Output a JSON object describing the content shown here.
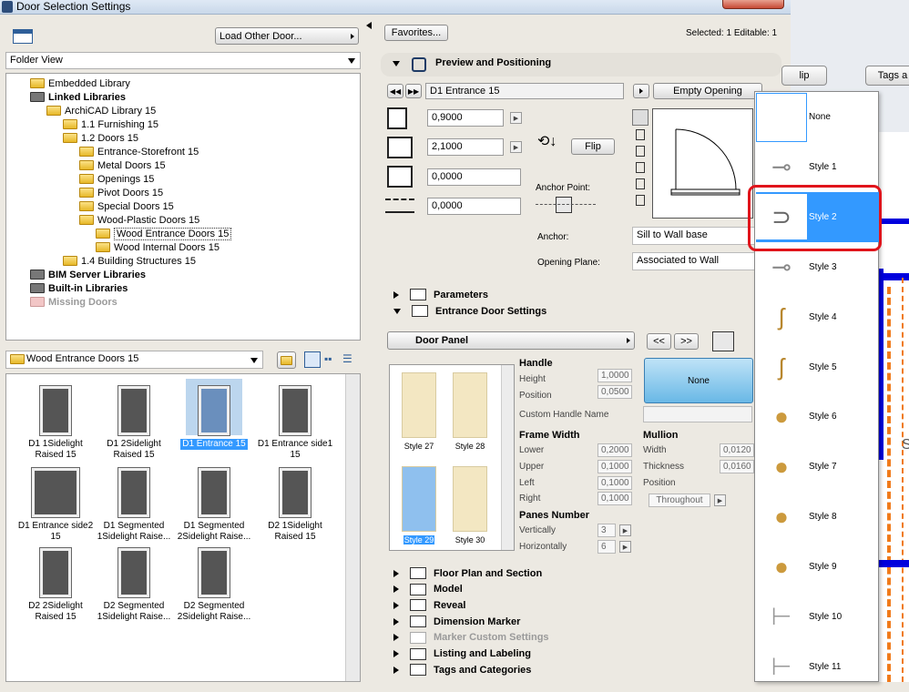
{
  "window": {
    "title": "Door Selection Settings"
  },
  "left": {
    "load_button": "Load Other Door...",
    "view_select": "Folder View",
    "tree": [
      {
        "label": "Embedded Library",
        "depth": 1,
        "bold": false,
        "grey": false
      },
      {
        "label": "Linked Libraries",
        "depth": 1,
        "bold": true,
        "grey": false
      },
      {
        "label": "ArchiCAD Library 15",
        "depth": 2,
        "bold": false,
        "grey": false
      },
      {
        "label": "1.1 Furnishing 15",
        "depth": 3,
        "bold": false,
        "grey": false
      },
      {
        "label": "1.2 Doors 15",
        "depth": 3,
        "bold": false,
        "grey": false
      },
      {
        "label": "Entrance-Storefront 15",
        "depth": 4,
        "bold": false,
        "grey": false
      },
      {
        "label": "Metal Doors 15",
        "depth": 4,
        "bold": false,
        "grey": false
      },
      {
        "label": "Openings 15",
        "depth": 4,
        "bold": false,
        "grey": false
      },
      {
        "label": "Pivot Doors 15",
        "depth": 4,
        "bold": false,
        "grey": false
      },
      {
        "label": "Special Doors 15",
        "depth": 4,
        "bold": false,
        "grey": false
      },
      {
        "label": "Wood-Plastic Doors 15",
        "depth": 4,
        "bold": false,
        "grey": false
      },
      {
        "label": "Wood Entrance Doors 15",
        "depth": 5,
        "bold": false,
        "grey": false,
        "selected": true
      },
      {
        "label": "Wood Internal Doors 15",
        "depth": 5,
        "bold": false,
        "grey": false
      },
      {
        "label": "1.4 Building Structures 15",
        "depth": 3,
        "bold": false,
        "grey": false
      },
      {
        "label": "BIM Server Libraries",
        "depth": 1,
        "bold": true,
        "grey": false
      },
      {
        "label": "Built-in Libraries",
        "depth": 1,
        "bold": true,
        "grey": false
      },
      {
        "label": "Missing Doors",
        "depth": 1,
        "bold": true,
        "grey": true
      }
    ],
    "folder_select": "Wood Entrance Doors 15",
    "thumbs": [
      {
        "label": "D1 1Sidelight Raised 15"
      },
      {
        "label": "D1 2Sidelight Raised 15"
      },
      {
        "label": "D1 Entrance 15",
        "selected": true
      },
      {
        "label": "D1 Entrance side1 15"
      },
      {
        "label": "D1 Entrance side2 15"
      },
      {
        "label": "D1 Segmented 1Sidelight Raise..."
      },
      {
        "label": "D1 Segmented 2Sidelight Raise..."
      },
      {
        "label": "D2 1Sidelight Raised 15"
      },
      {
        "label": "D2 2Sidelight Raised 15"
      },
      {
        "label": "D2 Segmented 1Sidelight Raise..."
      },
      {
        "label": "D2 Segmented 2Sidelight Raise..."
      }
    ]
  },
  "top": {
    "favorites": "Favorites...",
    "selected": "Selected: 1 Editable: 1"
  },
  "preview": {
    "title": "Preview and Positioning",
    "door_name": "D1 Entrance 15",
    "empty_opening": "Empty Opening",
    "width": "0,9000",
    "height": "2,1000",
    "val3": "0,0000",
    "val4": "0,0000",
    "flip": "Flip",
    "anchor_point": "Anchor Point:",
    "anchor_label": "Anchor:",
    "anchor_value": "Sill to Wall base",
    "opening_plane_label": "Opening Plane:",
    "opening_plane_value": "Associated to Wall"
  },
  "parameters_title": "Parameters",
  "entrance": {
    "title": "Entrance Door Settings",
    "door_panel": "Door Panel",
    "nav_prev": "<<",
    "nav_next": ">>",
    "styles": [
      {
        "label": "Style 27"
      },
      {
        "label": "Style 28"
      },
      {
        "label": "Style 29",
        "selected": true
      },
      {
        "label": "Style 30"
      }
    ],
    "handle_title": "Handle",
    "handle_height_label": "Height",
    "handle_height": "1,0000",
    "handle_position_label": "Position",
    "handle_position": "0,0500",
    "custom_handle_label": "Custom Handle Name",
    "handle_none": "None",
    "frame_title": "Frame Width",
    "lower_label": "Lower",
    "lower": "0,2000",
    "upper_label": "Upper",
    "upper": "0,1000",
    "left_label": "Left",
    "left": "0,1000",
    "right_label": "Right",
    "right": "0,1000",
    "mullion_title": "Mullion",
    "m_width_label": "Width",
    "m_width": "0,0120",
    "m_thick_label": "Thickness",
    "m_thick": "0,0160",
    "m_pos_label": "Position",
    "m_pos": "Throughout",
    "panes_title": "Panes Number",
    "vert_label": "Vertically",
    "vert": "3",
    "horiz_label": "Horizontally",
    "horiz": "6"
  },
  "sections": [
    {
      "label": "Floor Plan and Section",
      "disabled": false
    },
    {
      "label": "Model",
      "disabled": false
    },
    {
      "label": "Reveal",
      "disabled": false
    },
    {
      "label": "Dimension Marker",
      "disabled": false
    },
    {
      "label": "Marker Custom Settings",
      "disabled": true
    },
    {
      "label": "Listing and Labeling",
      "disabled": false
    },
    {
      "label": "Tags and Categories",
      "disabled": false
    }
  ],
  "popup": {
    "items": [
      {
        "label": "None",
        "icon": "none-icon"
      },
      {
        "label": "Style 1",
        "icon": "lever-handle-icon"
      },
      {
        "label": "Style 2",
        "icon": "pull-handle-icon",
        "selected": true
      },
      {
        "label": "Style 3",
        "icon": "lever-handle-icon"
      },
      {
        "label": "Style 4",
        "icon": "brass-lever-icon"
      },
      {
        "label": "Style 5",
        "icon": "brass-lever-icon"
      },
      {
        "label": "Style 6",
        "icon": "brass-knob-icon"
      },
      {
        "label": "Style 7",
        "icon": "brass-knob-icon"
      },
      {
        "label": "Style 8",
        "icon": "brass-knob-icon"
      },
      {
        "label": "Style 9",
        "icon": "brass-knob-icon"
      },
      {
        "label": "Style 10",
        "icon": "steel-lever-icon"
      },
      {
        "label": "Style 11",
        "icon": "steel-lever-icon"
      }
    ]
  },
  "background": {
    "flip_tab": "lip",
    "tags_tab": "Tags a",
    "side_letter": "S"
  },
  "colors": {
    "selection": "#3399ff",
    "highlight": "#e0141b",
    "panel": "#ece9e2"
  }
}
